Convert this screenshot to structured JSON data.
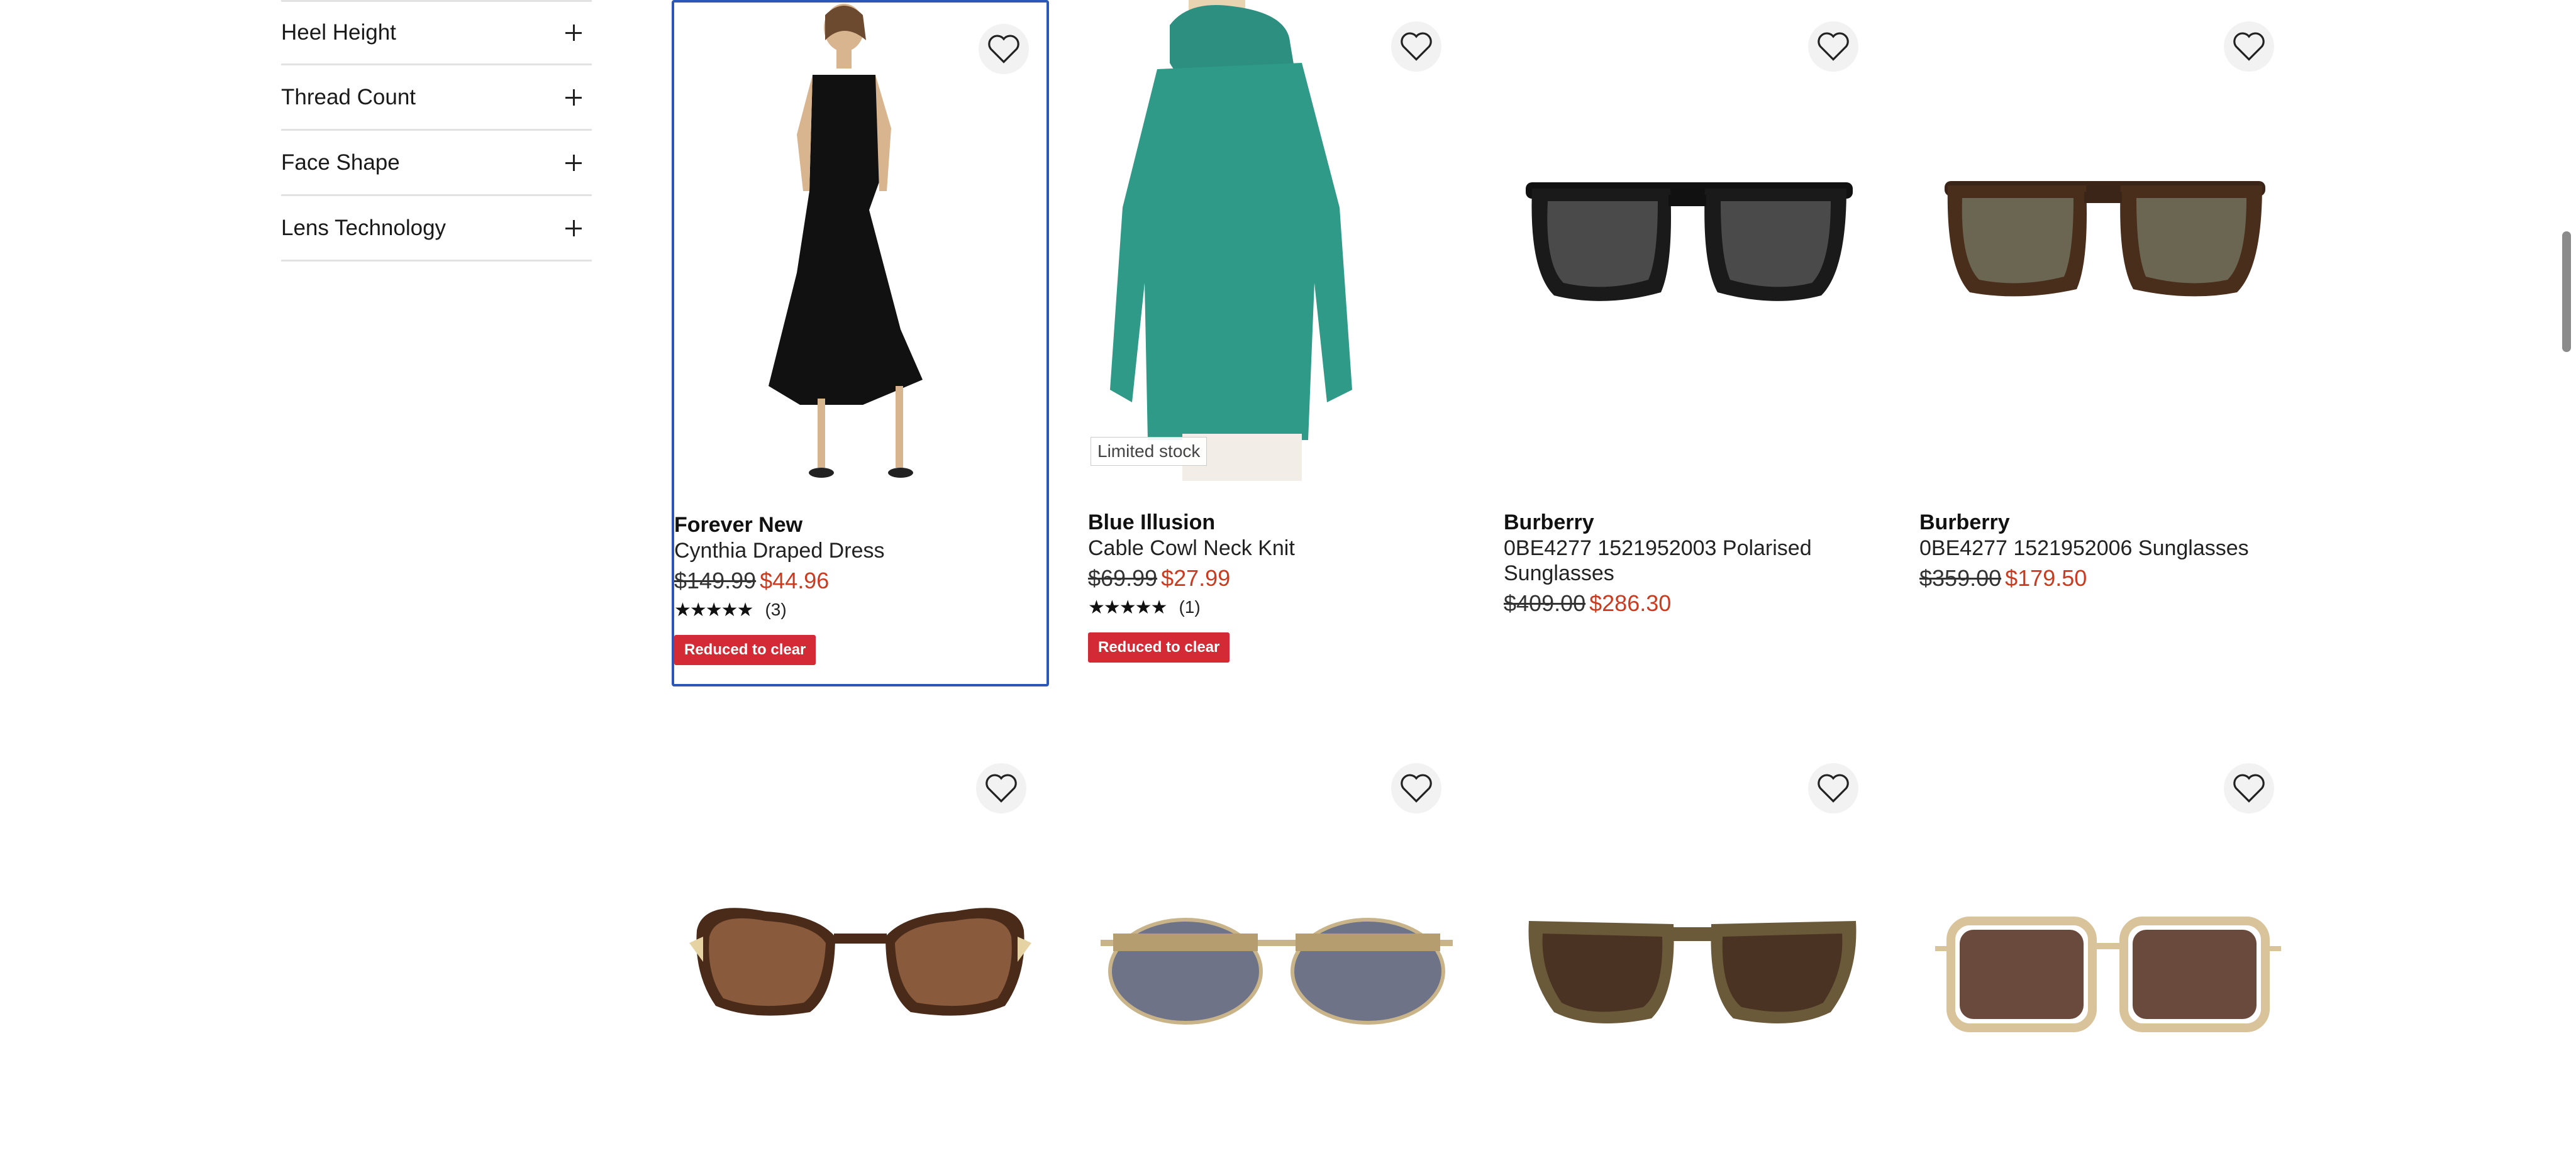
{
  "filters": [
    {
      "label": "Heel Height"
    },
    {
      "label": "Thread Count"
    },
    {
      "label": "Face Shape"
    },
    {
      "label": "Lens Technology"
    }
  ],
  "products": [
    {
      "brand": "Forever New",
      "name": "Cynthia Draped Dress",
      "was_price": "$149.99",
      "now_price": "$44.96",
      "rating_stars": "★★★★★",
      "rating_value": 4.5,
      "review_count": "(3)",
      "badge": "Reduced to clear"
    },
    {
      "brand": "Blue Illusion",
      "name": "Cable Cowl Neck Knit",
      "was_price": "$69.99",
      "now_price": "$27.99",
      "rating_stars": "★★★★★",
      "rating_value": 5,
      "review_count": "(1)",
      "badge": "Reduced to clear",
      "stock_label": "Limited stock"
    },
    {
      "brand": "Burberry",
      "name": "0BE4277 1521952003 Polarised Sunglasses",
      "was_price": "$409.00",
      "now_price": "$286.30"
    },
    {
      "brand": "Burberry",
      "name": "0BE4277 1521952006 Sunglasses",
      "was_price": "$359.00",
      "now_price": "$179.50"
    }
  ],
  "icons": {
    "wishlist": "heart-outline-icon",
    "expand": "plus-icon"
  },
  "colors": {
    "sale_price": "#cc3b1f",
    "badge_bg": "#d42a35",
    "selected_outline": "#2a57b8"
  }
}
